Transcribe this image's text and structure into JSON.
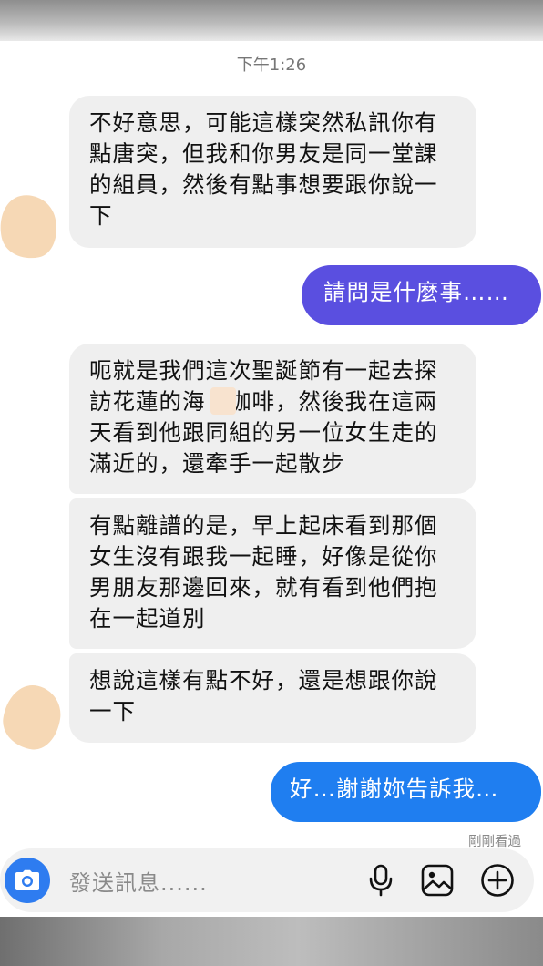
{
  "header": {
    "timestamp": "下午1:26"
  },
  "messages": [
    {
      "side": "incoming",
      "text": "不好意思，可能這樣突然私訊你有\n點唐突，但我和你男友是同一堂課\n的組員，然後有點事想要跟你說一\n下"
    },
    {
      "side": "outgoing",
      "text": "請問是什麼事……"
    },
    {
      "side": "incoming",
      "text": "呃就是我們這次聖誕節有一起去探\n訪花蓮的海　咖啡，然後我在這兩\n天看到他跟同組的另一位女生走的\n滿近的，還牽手一起散步"
    },
    {
      "side": "incoming",
      "text": "有點離譜的是，早上起床看到那個\n女生沒有跟我一起睡，好像是從你\n男朋友那邊回來，就有看到他們抱\n在一起道別"
    },
    {
      "side": "incoming",
      "text": "想說這樣有點不好，還是想跟你說\n一下"
    },
    {
      "side": "outgoing",
      "text": "好…謝謝妳告訴我…"
    }
  ],
  "status": {
    "seen": "剛剛看過"
  },
  "composer": {
    "placeholder": "發送訊息......",
    "icons": [
      "camera-icon",
      "microphone-icon",
      "gallery-icon",
      "add-icon"
    ]
  },
  "colors": {
    "outgoing_purple": "#5a4fe0",
    "outgoing_blue": "#1f7ef0",
    "incoming_bg": "#efefef",
    "camera_button": "#2e7cf0"
  }
}
